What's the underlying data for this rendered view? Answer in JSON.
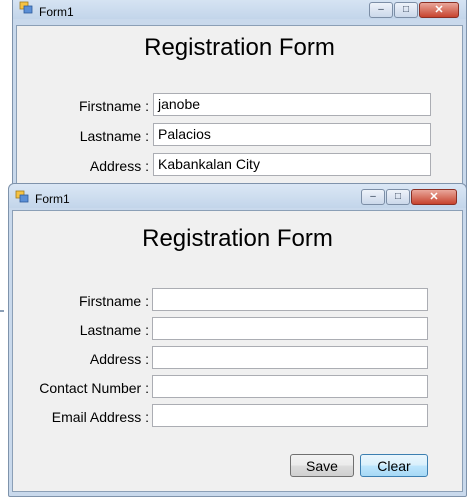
{
  "back_window": {
    "title": "Form1",
    "heading": "Registration Form",
    "fields": [
      {
        "label": "Firstname :",
        "value": "janobe"
      },
      {
        "label": "Lastname :",
        "value": "Palacios"
      },
      {
        "label": "Address :",
        "value": "Kabankalan City"
      }
    ],
    "controls": {
      "minimize": "–",
      "maximize": "□",
      "close": "✕"
    }
  },
  "front_window": {
    "title": "Form1",
    "heading": "Registration Form",
    "fields": [
      {
        "label": "Firstname :",
        "value": ""
      },
      {
        "label": "Lastname :",
        "value": ""
      },
      {
        "label": "Address :",
        "value": ""
      },
      {
        "label": "Contact Number :",
        "value": ""
      },
      {
        "label": "Email Address :",
        "value": ""
      }
    ],
    "buttons": {
      "save": "Save",
      "clear": "Clear"
    },
    "controls": {
      "minimize": "–",
      "maximize": "□",
      "close": "✕"
    }
  },
  "colors": {
    "title_gradient_top": "#dbe7f5",
    "title_gradient_bottom": "#c3d5ea",
    "client_bg": "#f0f0f0",
    "close_button": "#c7432e"
  }
}
